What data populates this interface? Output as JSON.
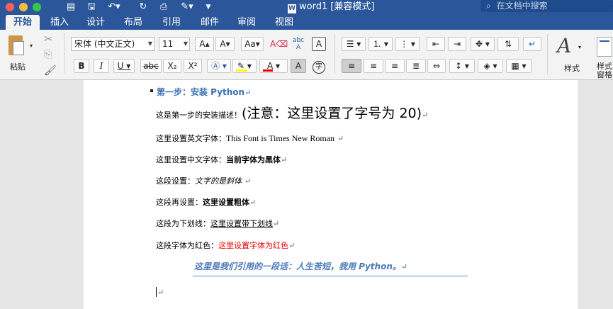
{
  "window": {
    "title": "word1 [兼容模式]",
    "search_placeholder": "在文档中搜索"
  },
  "tabs": [
    "开始",
    "插入",
    "设计",
    "布局",
    "引用",
    "邮件",
    "审阅",
    "视图"
  ],
  "ribbon": {
    "paste_label": "粘贴",
    "font_name": "宋体 (中文正文)",
    "font_size": "11",
    "styles_label": "样式",
    "styles_pane_label": "样式窗格",
    "bold": "B",
    "italic": "I",
    "underline": "U",
    "strike": "abc",
    "subscript": "X₂",
    "superscript": "X²",
    "phonetic": "abc",
    "char_border": "A",
    "char_shading": "A",
    "enclose": "字",
    "font_color_hex": "#e00000",
    "highlight_color_hex": "#ffff00"
  },
  "document": {
    "heading": "第一步：安装 Python",
    "line1_prefix": "这是第一步的安装描述！",
    "line1_big": "(注意：这里设置了字号为 20)",
    "line2_prefix": "这里设置英文字体：",
    "line2_value": "This Font is Times New Roman",
    "line3_prefix": "这里设置中文字体：",
    "line3_value": "当前字体为黑体",
    "line4_prefix": "这段设置：",
    "line4_value": "文字的是斜体",
    "line5_prefix": "这段再设置：",
    "line5_value": "这里设置粗体",
    "line6_prefix": "这段为下划线：",
    "line6_value": "这里设置带下划线",
    "line7_prefix": "这段字体为红色：",
    "line7_value": "这里设置字体为红色",
    "quote": "这里是我们引用的一段话：人生苦短，我用 Python。",
    "para_mark": "↵"
  }
}
